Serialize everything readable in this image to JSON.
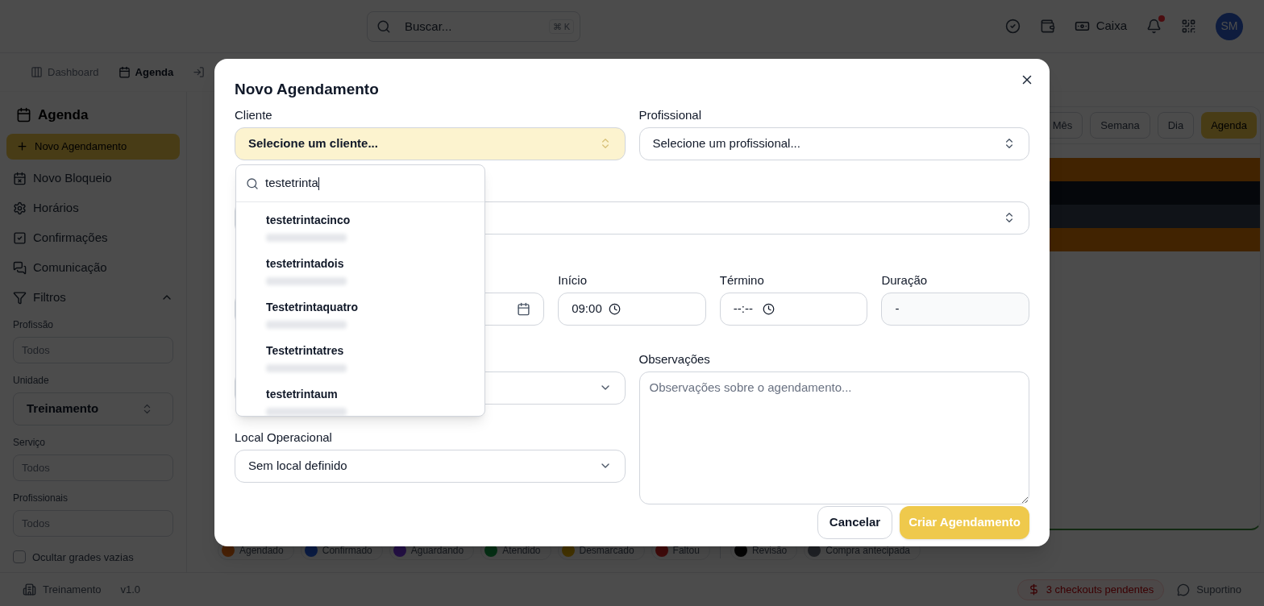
{
  "header": {
    "search": {
      "placeholder": "Buscar...",
      "shortcut": "⌘ K"
    },
    "cash_label": "Caixa",
    "notification_dot": true,
    "avatar": "SM"
  },
  "nav_tabs": [
    {
      "label": "Dashboard",
      "selected": false
    },
    {
      "label": "Agenda",
      "selected": true
    }
  ],
  "sidebar": {
    "title": "Agenda",
    "primary_action": "Novo Agendamento",
    "items": [
      "Novo Bloqueio",
      "Horários",
      "Confirmações",
      "Comunicação"
    ],
    "filters": {
      "label": "Filtros",
      "expanded": true,
      "fields": [
        {
          "label": "Profissão",
          "placeholder": "Todos",
          "kind": "input"
        },
        {
          "label": "Unidade",
          "value": "Treinamento",
          "kind": "select"
        },
        {
          "label": "Serviço",
          "placeholder": "Todos",
          "kind": "input"
        },
        {
          "label": "Profissionais",
          "placeholder": "Todos",
          "kind": "input"
        }
      ],
      "hide_empty": {
        "label": "Ocultar grades vazias",
        "checked": false
      }
    }
  },
  "calendar": {
    "views": [
      {
        "label": "Mês",
        "selected": false
      },
      {
        "label": "Semana",
        "selected": false
      },
      {
        "label": "Dia",
        "selected": false
      },
      {
        "label": "Agenda",
        "selected": true
      }
    ],
    "status_legend": [
      "Agendado",
      "Confirmado",
      "Aguardando",
      "Atendido",
      "Desmarcado",
      "Faltou"
    ],
    "extra_legend": [
      "Revisão",
      "Compra antecipada"
    ]
  },
  "status_bar": {
    "unit": "Treinamento",
    "version": "v1.0",
    "checkouts": "3 checkouts pendentes",
    "support": "Suportino"
  },
  "modal": {
    "title": "Novo Agendamento",
    "client": {
      "label": "Cliente",
      "placeholder": "Selecione um cliente...",
      "open": true
    },
    "professional": {
      "label": "Profissional",
      "placeholder": "Selecione um profissional..."
    },
    "start": {
      "label": "Início",
      "value": "09:00"
    },
    "end": {
      "label": "Término",
      "value": "--:--"
    },
    "duration": {
      "label": "Duração",
      "value": "-"
    },
    "location": {
      "label": "Local Operacional",
      "value": "Sem local definido"
    },
    "notes": {
      "label": "Observações",
      "placeholder": "Observações sobre o agendamento..."
    },
    "buttons": {
      "cancel": "Cancelar",
      "submit": "Criar Agendamento"
    },
    "client_dropdown": {
      "query": "testetrinta",
      "options": [
        {
          "name": "testetrintacinco"
        },
        {
          "name": "testetrintadois"
        },
        {
          "name": "Testetrintaquatro"
        },
        {
          "name": "Testetrintatres"
        },
        {
          "name": "testetrintaum"
        }
      ]
    }
  }
}
